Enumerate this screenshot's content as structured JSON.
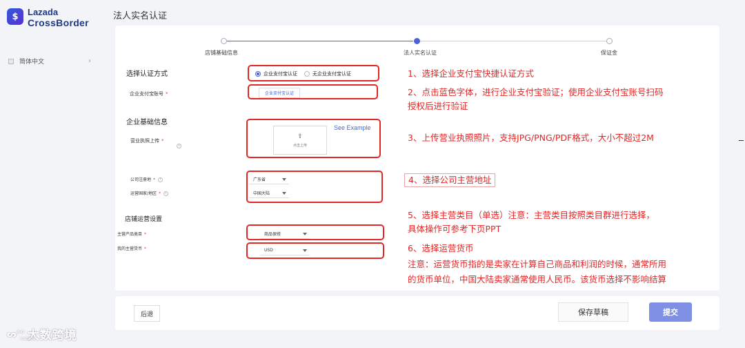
{
  "sidebar": {
    "logo_badge": "$",
    "logo_line1": "Lazada",
    "logo_line2": "CrossBorder",
    "language": "简体中文"
  },
  "page_title": "法人实名认证",
  "steps": [
    {
      "label": "店铺基础信息",
      "state": "done"
    },
    {
      "label": "法人实名认证",
      "state": "current"
    },
    {
      "label": "保证金",
      "state": "todo"
    }
  ],
  "form": {
    "verify_method": {
      "title": "选择认证方式",
      "options": [
        "企业支付宝认证",
        "无企业支付宝认证"
      ],
      "selected": 0
    },
    "alipay_account": {
      "label": "企业支付宝账号",
      "link": "企业支付宝认证"
    },
    "basic_info": {
      "title": "企业基础信息",
      "license_label": "营业执照上传",
      "upload_text": "点击上传",
      "see_example": "See Example"
    },
    "address": {
      "reg_label": "公司注册地",
      "reg_value": "广东省",
      "ops_label": "运营国家/地区",
      "ops_value": "中国大陆"
    },
    "store_ops": {
      "title": "店铺运营设置",
      "category_label": "主营产品类目",
      "category_value": "商品保修",
      "currency_label": "我的主营货币",
      "currency_value": "USD"
    }
  },
  "notes": {
    "n1": "1、选择企业支付宝快捷认证方式",
    "n2a": "2、点击蓝色字体，进行企业支付宝验证；使用企业支付宝账号扫码",
    "n2b": "授权后进行验证",
    "n3": "3、上传营业执照照片，支持JPG/PNG/PDF格式，大小不超过2M",
    "n4": "4、选择公司主营地址",
    "n5a": "5、选择主营类目（单选）注意：主营类目按照类目群进行选择，",
    "n5b": "具体操作可参考下页PPT",
    "n6a": "6、选择运营货币",
    "n6b": "注意：运营货币指的是卖家在计算自己商品和利润的时候，通常所用",
    "n6c": "的货币单位，中国大陆卖家通常使用人民币。该货币选择不影响结算"
  },
  "footer": {
    "back": "后退",
    "save_draft": "保存草稿",
    "submit": "提交"
  },
  "watermark": {
    "small": "Lazada",
    "text": "大数跨境"
  },
  "colors": {
    "accent": "#4a63d6",
    "annotation_red": "#e12626",
    "submit_bg": "#7f8fe4"
  }
}
